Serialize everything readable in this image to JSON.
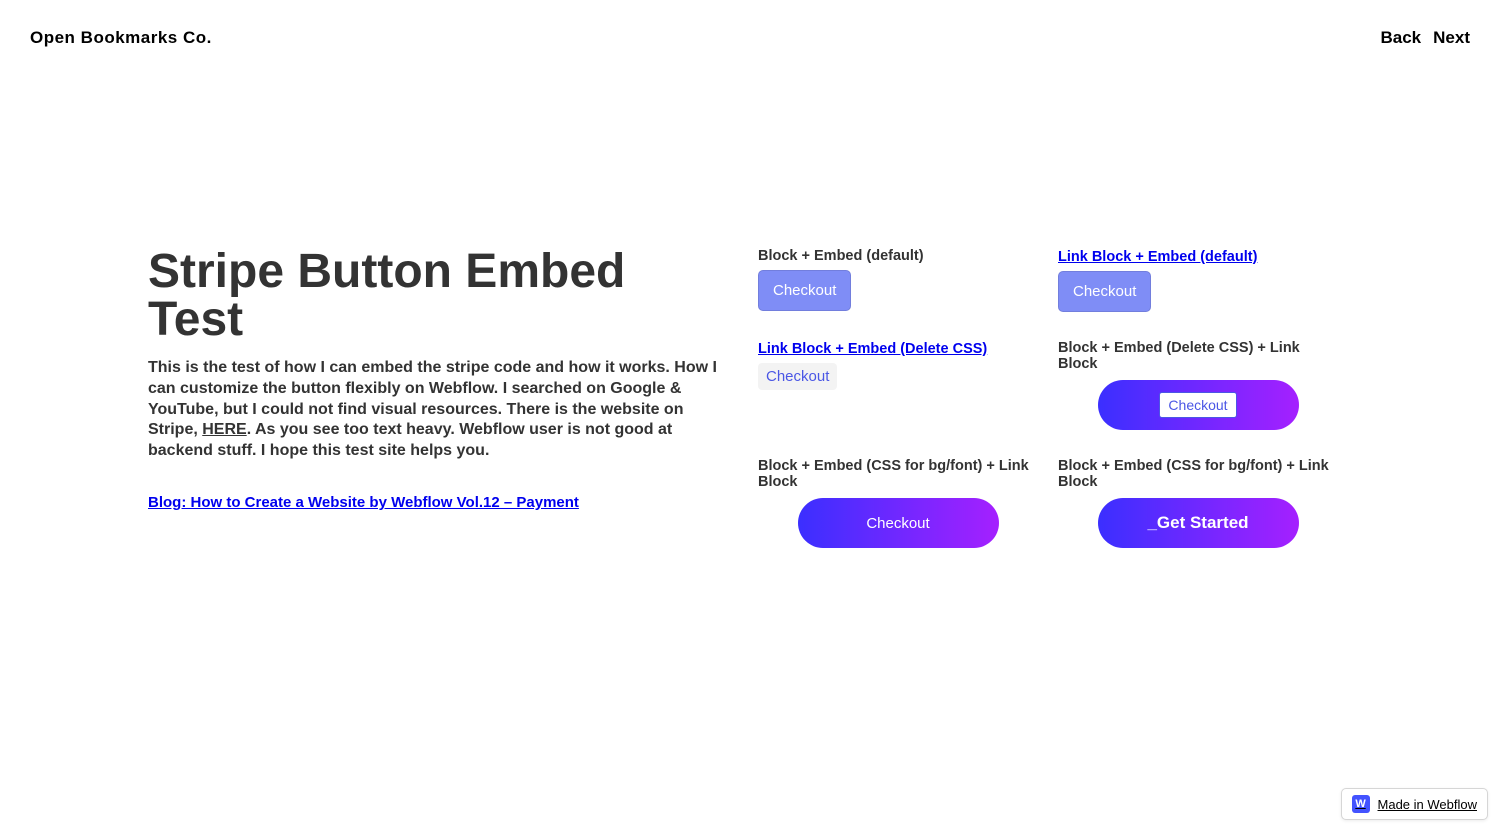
{
  "header": {
    "site_title": "Open Bookmarks Co.",
    "nav": {
      "back": "Back",
      "next": "Next"
    }
  },
  "page": {
    "title": "Stripe Button Embed Test",
    "desc_1": "This is the test of how I can embed the stripe code and how it works. How I can customize the button flexibly on Webflow. I searched on Google & YouTube, but I could not find visual resources. There is the website on Stripe, ",
    "here": "HERE",
    "desc_2": ". As you see too text heavy. Webflow user is not good at backend stuff. I hope this test site helps you.",
    "blog_link": "Blog: How to Create a Website by Webflow Vol.12 – Payment"
  },
  "cells": {
    "c1": {
      "label": "Block + Embed (default)",
      "btn": "Checkout"
    },
    "c2": {
      "label": "Link Block + Embed (default)",
      "btn": "Checkout"
    },
    "c3": {
      "label": "Link Block + Embed (Delete CSS)",
      "btn": "Checkout"
    },
    "c4": {
      "label": "Block + Embed (Delete CSS) + Link Block",
      "btn": "Checkout"
    },
    "c5": {
      "label": "Block + Embed (CSS for bg/font) + Link Block",
      "btn": "Checkout"
    },
    "c6": {
      "label": "Block + Embed (CSS for bg/font) + Link Block",
      "btn": "_Get Started"
    }
  },
  "badge": {
    "text": "Made in Webflow",
    "icon": "W"
  }
}
